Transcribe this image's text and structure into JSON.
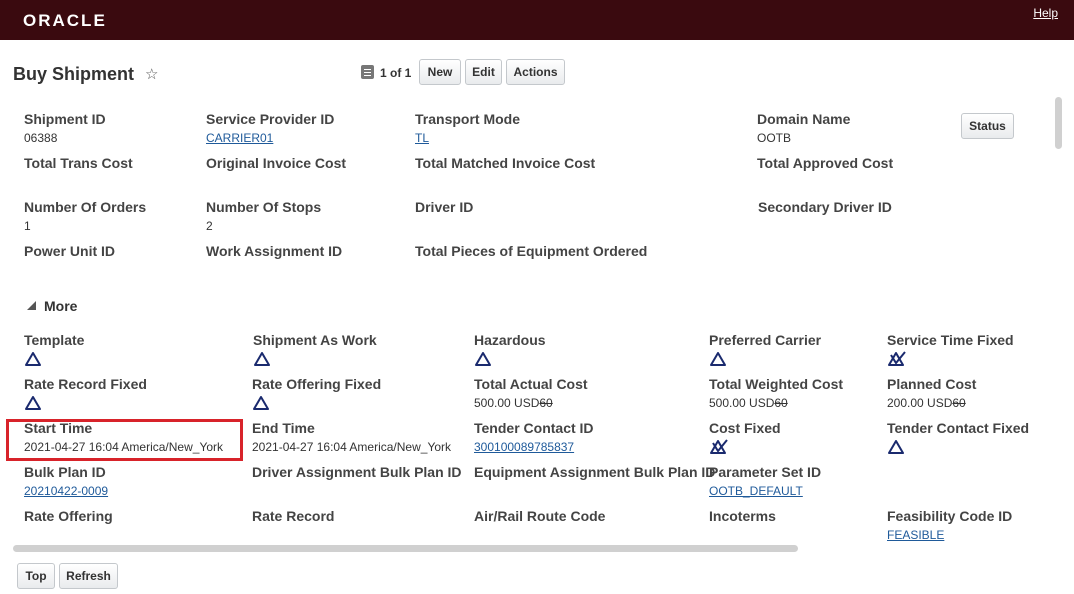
{
  "header": {
    "logo": "ORACLE",
    "help": "Help"
  },
  "page": {
    "title": "Buy Shipment",
    "star": "☆",
    "pager": "1 of 1"
  },
  "toolbar": {
    "new": "New",
    "edit": "Edit",
    "actions": "Actions",
    "status": "Status"
  },
  "main": {
    "shipment_id": {
      "label": "Shipment ID",
      "value": "06388"
    },
    "service_provider_id": {
      "label": "Service Provider ID",
      "value": "CARRIER01"
    },
    "transport_mode": {
      "label": "Transport Mode",
      "value": "TL"
    },
    "domain_name": {
      "label": "Domain Name",
      "value": "OOTB"
    },
    "total_trans_cost": {
      "label": "Total Trans Cost"
    },
    "original_invoice_cost": {
      "label": "Original Invoice Cost"
    },
    "total_matched_invoice_cost": {
      "label": "Total Matched Invoice Cost"
    },
    "total_approved_cost": {
      "label": "Total Approved Cost"
    },
    "number_of_orders": {
      "label": "Number Of Orders",
      "value": "1"
    },
    "number_of_stops": {
      "label": "Number Of Stops",
      "value": "2"
    },
    "driver_id": {
      "label": "Driver ID"
    },
    "secondary_driver_id": {
      "label": "Secondary Driver ID"
    },
    "power_unit_id": {
      "label": "Power Unit ID"
    },
    "work_assignment_id": {
      "label": "Work Assignment ID"
    },
    "total_pieces": {
      "label": "Total Pieces of Equipment Ordered"
    }
  },
  "more": {
    "label": "More",
    "template": {
      "label": "Template"
    },
    "shipment_as_work": {
      "label": "Shipment As Work"
    },
    "hazardous": {
      "label": "Hazardous"
    },
    "preferred_carrier": {
      "label": "Preferred Carrier"
    },
    "service_time_fixed": {
      "label": "Service Time Fixed"
    },
    "rate_record_fixed": {
      "label": "Rate Record Fixed"
    },
    "rate_offering_fixed": {
      "label": "Rate Offering Fixed"
    },
    "total_actual_cost": {
      "label": "Total Actual Cost",
      "value": "500.00 USD",
      "suffix": "60"
    },
    "total_weighted_cost": {
      "label": "Total Weighted Cost",
      "value": "500.00 USD",
      "suffix": "60"
    },
    "planned_cost": {
      "label": "Planned Cost",
      "value": "200.00 USD",
      "suffix": "60"
    },
    "start_time": {
      "label": "Start Time",
      "value": "2021-04-27 16:04 America/New_York"
    },
    "end_time": {
      "label": "End Time",
      "value": "2021-04-27 16:04 America/New_York"
    },
    "tender_contact_id": {
      "label": "Tender Contact ID",
      "value": "300100089785837"
    },
    "cost_fixed": {
      "label": "Cost Fixed"
    },
    "tender_contact_fixed": {
      "label": "Tender Contact Fixed"
    },
    "bulk_plan_id": {
      "label": "Bulk Plan ID",
      "value": "20210422-0009"
    },
    "driver_assignment_bulk_plan_id": {
      "label": "Driver Assignment Bulk Plan ID"
    },
    "equipment_assignment_bulk_plan_id": {
      "label": "Equipment Assignment Bulk Plan ID"
    },
    "parameter_set_id": {
      "label": "Parameter Set ID",
      "value": "OOTB_DEFAULT"
    },
    "rate_offering": {
      "label": "Rate Offering"
    },
    "rate_record": {
      "label": "Rate Record"
    },
    "air_rail_route_code": {
      "label": "Air/Rail Route Code"
    },
    "incoterms": {
      "label": "Incoterms"
    },
    "feasibility_code_id": {
      "label": "Feasibility Code ID",
      "value": "FEASIBLE"
    }
  },
  "footer": {
    "top": "Top",
    "refresh": "Refresh"
  }
}
